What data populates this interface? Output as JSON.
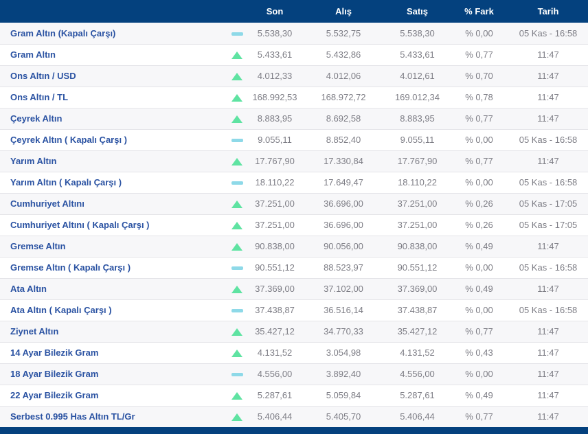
{
  "colors": {
    "header_bg": "#04417e",
    "label_blue": "#2a52a2",
    "value_gray": "#7d7d85",
    "up_green": "#5fe3a2",
    "flat_cyan": "#8ed9e8",
    "row_alt_bg": "#f7f7f9",
    "row_border": "#e4e4e8"
  },
  "table": {
    "columns": {
      "name": "",
      "trend": "",
      "son": "Son",
      "alis": "Alış",
      "satis": "Satış",
      "fark": "% Fark",
      "tarih": "Tarih"
    },
    "trend_icons": {
      "up": "triangle-up-icon",
      "flat": "dash-icon"
    },
    "rows": [
      {
        "name": "Gram Altın (Kapalı Çarşı)",
        "trend": "flat",
        "son": "5.538,30",
        "alis": "5.532,75",
        "satis": "5.538,30",
        "fark": "% 0,00",
        "tarih": "05 Kas - 16:58"
      },
      {
        "name": "Gram Altın",
        "trend": "up",
        "son": "5.433,61",
        "alis": "5.432,86",
        "satis": "5.433,61",
        "fark": "% 0,77",
        "tarih": "11:47"
      },
      {
        "name": "Ons Altın / USD",
        "trend": "up",
        "son": "4.012,33",
        "alis": "4.012,06",
        "satis": "4.012,61",
        "fark": "% 0,70",
        "tarih": "11:47"
      },
      {
        "name": "Ons Altın / TL",
        "trend": "up",
        "son": "168.992,53",
        "alis": "168.972,72",
        "satis": "169.012,34",
        "fark": "% 0,78",
        "tarih": "11:47"
      },
      {
        "name": "Çeyrek Altın",
        "trend": "up",
        "son": "8.883,95",
        "alis": "8.692,58",
        "satis": "8.883,95",
        "fark": "% 0,77",
        "tarih": "11:47"
      },
      {
        "name": "Çeyrek Altın ( Kapalı Çarşı )",
        "trend": "flat",
        "son": "9.055,11",
        "alis": "8.852,40",
        "satis": "9.055,11",
        "fark": "% 0,00",
        "tarih": "05 Kas - 16:58"
      },
      {
        "name": "Yarım Altın",
        "trend": "up",
        "son": "17.767,90",
        "alis": "17.330,84",
        "satis": "17.767,90",
        "fark": "% 0,77",
        "tarih": "11:47"
      },
      {
        "name": "Yarım Altın ( Kapalı Çarşı )",
        "trend": "flat",
        "son": "18.110,22",
        "alis": "17.649,47",
        "satis": "18.110,22",
        "fark": "% 0,00",
        "tarih": "05 Kas - 16:58"
      },
      {
        "name": "Cumhuriyet Altını",
        "trend": "up",
        "son": "37.251,00",
        "alis": "36.696,00",
        "satis": "37.251,00",
        "fark": "% 0,26",
        "tarih": "05 Kas - 17:05"
      },
      {
        "name": "Cumhuriyet Altını ( Kapalı Çarşı )",
        "trend": "up",
        "son": "37.251,00",
        "alis": "36.696,00",
        "satis": "37.251,00",
        "fark": "% 0,26",
        "tarih": "05 Kas - 17:05"
      },
      {
        "name": "Gremse Altın",
        "trend": "up",
        "son": "90.838,00",
        "alis": "90.056,00",
        "satis": "90.838,00",
        "fark": "% 0,49",
        "tarih": "11:47"
      },
      {
        "name": "Gremse Altın ( Kapalı Çarşı )",
        "trend": "flat",
        "son": "90.551,12",
        "alis": "88.523,97",
        "satis": "90.551,12",
        "fark": "% 0,00",
        "tarih": "05 Kas - 16:58"
      },
      {
        "name": "Ata Altın",
        "trend": "up",
        "son": "37.369,00",
        "alis": "37.102,00",
        "satis": "37.369,00",
        "fark": "% 0,49",
        "tarih": "11:47"
      },
      {
        "name": "Ata Altın ( Kapalı Çarşı )",
        "trend": "flat",
        "son": "37.438,87",
        "alis": "36.516,14",
        "satis": "37.438,87",
        "fark": "% 0,00",
        "tarih": "05 Kas - 16:58"
      },
      {
        "name": "Ziynet Altın",
        "trend": "up",
        "son": "35.427,12",
        "alis": "34.770,33",
        "satis": "35.427,12",
        "fark": "% 0,77",
        "tarih": "11:47"
      },
      {
        "name": "14 Ayar Bilezik Gram",
        "trend": "up",
        "son": "4.131,52",
        "alis": "3.054,98",
        "satis": "4.131,52",
        "fark": "% 0,43",
        "tarih": "11:47"
      },
      {
        "name": "18 Ayar Bilezik Gram",
        "trend": "flat",
        "son": "4.556,00",
        "alis": "3.892,40",
        "satis": "4.556,00",
        "fark": "% 0,00",
        "tarih": "11:47"
      },
      {
        "name": "22 Ayar Bilezik Gram",
        "trend": "up",
        "son": "5.287,61",
        "alis": "5.059,84",
        "satis": "5.287,61",
        "fark": "% 0,49",
        "tarih": "11:47"
      },
      {
        "name": "Serbest 0.995 Has Altın TL/Gr",
        "trend": "up",
        "son": "5.406,44",
        "alis": "5.405,70",
        "satis": "5.406,44",
        "fark": "% 0,77",
        "tarih": "11:47"
      }
    ]
  }
}
